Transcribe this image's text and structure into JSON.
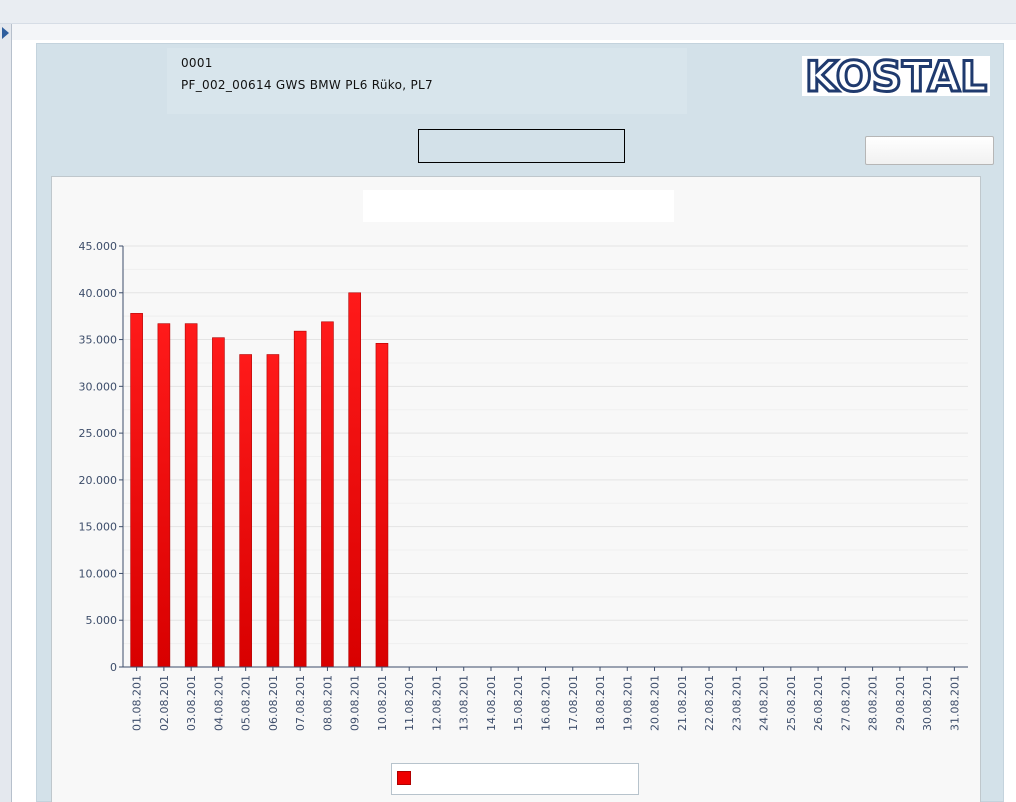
{
  "header": {
    "plant_id": "0001",
    "plant_name": "PF_002_00614 GWS BMW PL6 Rüko, PL7",
    "logo_text": "KOSTAL"
  },
  "colors": {
    "logo": "#1f3a6e",
    "bar": "#ee0000",
    "axis": "#3d4d6a",
    "panel": "#d3e1e9"
  },
  "chart_data": {
    "type": "bar",
    "categories": [
      "01.08.201",
      "02.08.201",
      "03.08.201",
      "04.08.201",
      "05.08.201",
      "06.08.201",
      "07.08.201",
      "08.08.201",
      "09.08.201",
      "10.08.201",
      "11.08.201",
      "12.08.201",
      "13.08.201",
      "14.08.201",
      "15.08.201",
      "16.08.201",
      "17.08.201",
      "18.08.201",
      "19.08.201",
      "20.08.201",
      "21.08.201",
      "22.08.201",
      "23.08.201",
      "24.08.201",
      "25.08.201",
      "26.08.201",
      "27.08.201",
      "28.08.201",
      "29.08.201",
      "30.08.201",
      "31.08.201"
    ],
    "values": [
      37800,
      36700,
      36700,
      35200,
      33400,
      33400,
      35900,
      36900,
      40000,
      34600,
      0,
      0,
      0,
      0,
      0,
      0,
      0,
      0,
      0,
      0,
      0,
      0,
      0,
      0,
      0,
      0,
      0,
      0,
      0,
      0,
      0
    ],
    "ylim": [
      0,
      45000
    ],
    "yticks": [
      0,
      5000,
      10000,
      15000,
      20000,
      25000,
      30000,
      35000,
      40000,
      45000
    ],
    "ytick_labels": [
      "0",
      "5.000",
      "10.000",
      "15.000",
      "20.000",
      "25.000",
      "30.000",
      "35.000",
      "40.000",
      "45.000"
    ],
    "title": "",
    "xlabel": "",
    "ylabel": "",
    "grid": true,
    "legend": "bottom"
  }
}
